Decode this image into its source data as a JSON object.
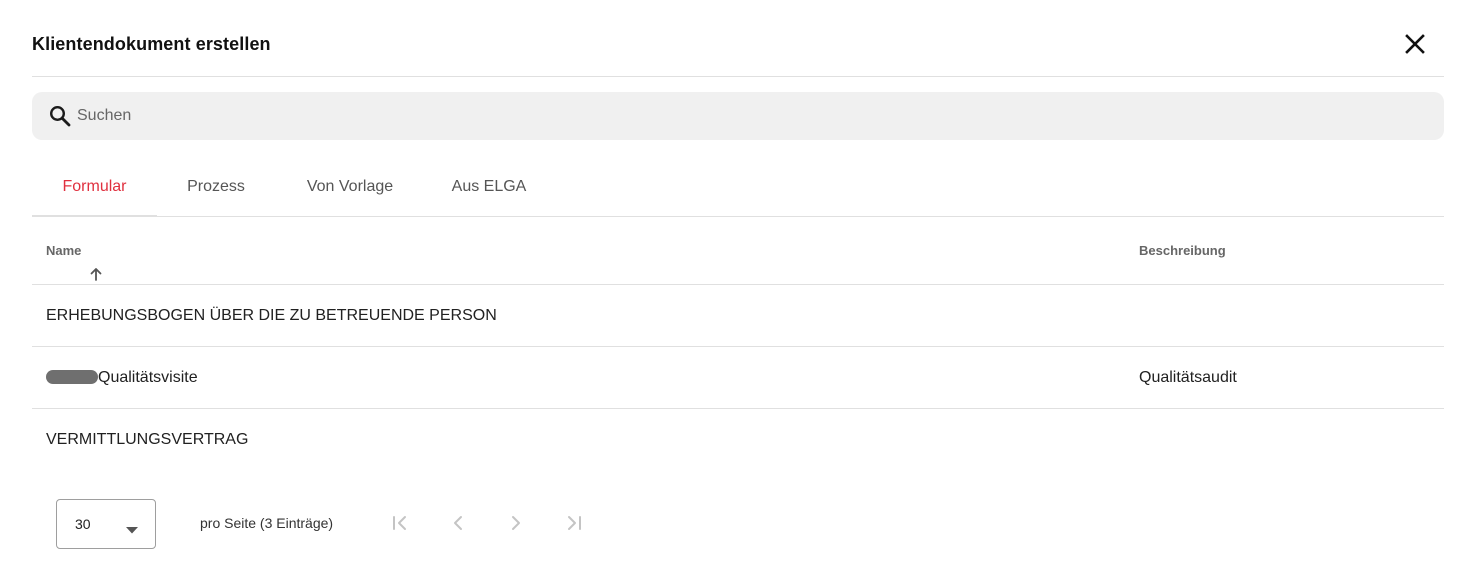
{
  "dialog": {
    "title": "Klientendokument erstellen",
    "close_icon": "close-icon"
  },
  "search": {
    "placeholder": "Suchen",
    "value": "",
    "icon": "search-icon"
  },
  "tabs": [
    {
      "label": "Formular",
      "active": true
    },
    {
      "label": "Prozess",
      "active": false
    },
    {
      "label": "Von Vorlage",
      "active": false
    },
    {
      "label": "Aus ELGA",
      "active": false
    }
  ],
  "table": {
    "columns": {
      "name": "Name",
      "description": "Beschreibung"
    },
    "sort": {
      "column": "name",
      "direction": "ascending",
      "icon": "arrow-up-icon"
    },
    "rows": [
      {
        "name": "ERHEBUNGSBOGEN ÜBER DIE ZU BETREUENDE PERSON",
        "description": ""
      },
      {
        "name": "Qualitätsvisite",
        "description": "Qualitätsaudit",
        "name_prefix_redacted": true
      },
      {
        "name": "VERMITTLUNGSVERTRAG",
        "description": ""
      }
    ]
  },
  "pagination": {
    "page_size": "30",
    "summary": "pro Seite (3 Einträge)",
    "buttons": [
      "first-page-icon",
      "previous-page-icon",
      "next-page-icon",
      "last-page-icon"
    ]
  },
  "colors": {
    "accent": "#e0303f",
    "search_background": "#f0f0f0",
    "divider": "#e0e0e0",
    "disabled_icon": "#c4c4c4"
  }
}
